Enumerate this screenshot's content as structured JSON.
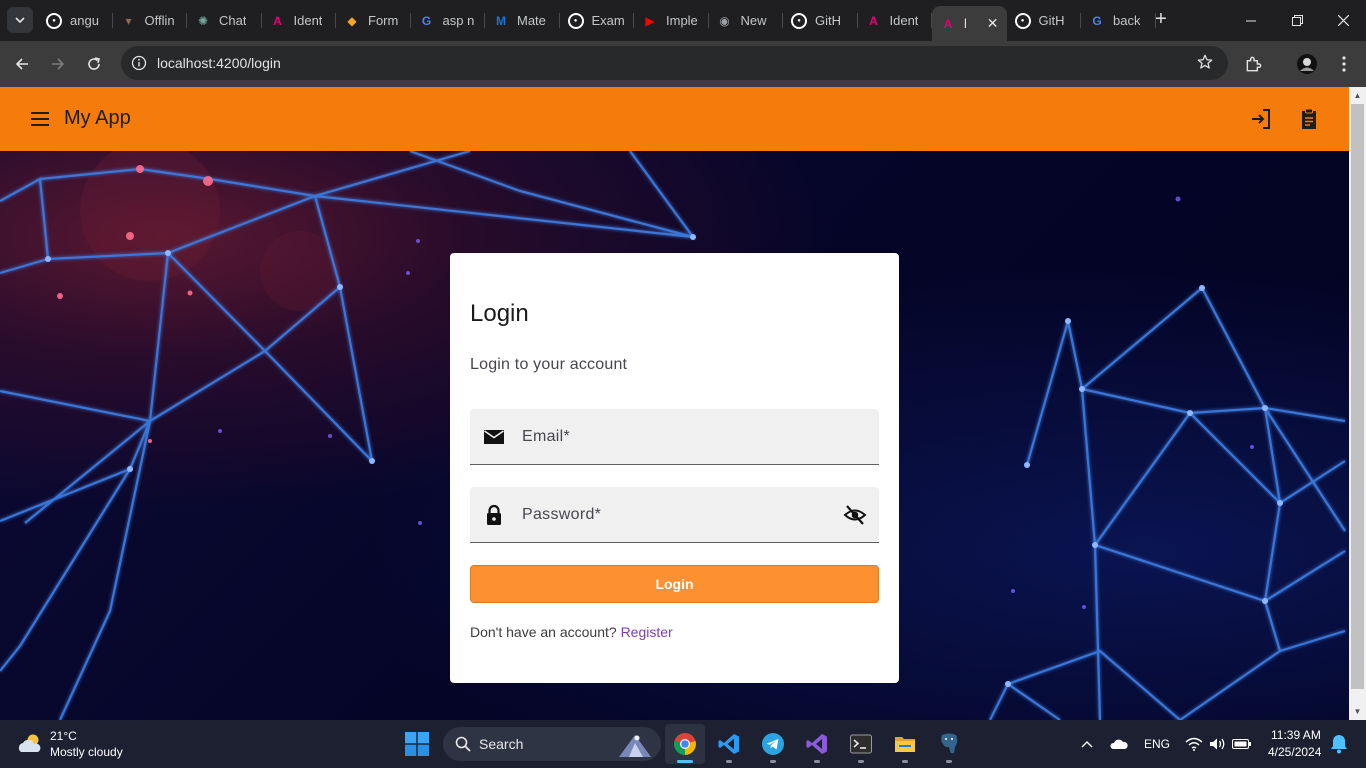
{
  "browser": {
    "tabs": [
      {
        "title": "angu",
        "icon": "github-icon",
        "color": "#ffffff"
      },
      {
        "title": "Offlin",
        "icon": "offline-icon",
        "color": "#8a6a58"
      },
      {
        "title": "Chat",
        "icon": "chatgpt-icon",
        "color": "#74aa9c"
      },
      {
        "title": "Ident",
        "icon": "angular-icon",
        "color": "#e40078"
      },
      {
        "title": "Form",
        "icon": "shield-icon",
        "color": "#f5a623"
      },
      {
        "title": "asp n",
        "icon": "google-icon",
        "color": "#4285f4"
      },
      {
        "title": "Mate",
        "icon": "mui-icon",
        "color": "#1976d2"
      },
      {
        "title": "Exam",
        "icon": "github-icon",
        "color": "#ffffff"
      },
      {
        "title": "Imple",
        "icon": "youtube-icon",
        "color": "#ff0000"
      },
      {
        "title": "New",
        "icon": "chrome-icon",
        "color": "#9aa0a6"
      },
      {
        "title": "GitH",
        "icon": "github-icon",
        "color": "#ffffff"
      },
      {
        "title": "Ident",
        "icon": "angular-icon",
        "color": "#e40078"
      },
      {
        "title": "l",
        "icon": "angular-icon",
        "color": "#e40078",
        "active": true
      },
      {
        "title": "GitH",
        "icon": "github-icon",
        "color": "#ffffff"
      },
      {
        "title": "back",
        "icon": "google-icon",
        "color": "#4285f4"
      }
    ],
    "url": "localhost:4200/login"
  },
  "app": {
    "title": "My App",
    "accent": "#f57c0b"
  },
  "login": {
    "title": "Login",
    "subtitle": "Login to your account",
    "email_label": "Email*",
    "password_label": "Password*",
    "submit_label": "Login",
    "no_account_text": "Don't have an account?",
    "register_link": "Register",
    "button_color": "#fd9031"
  },
  "taskbar": {
    "weather": {
      "temp": "21°C",
      "desc": "Mostly cloudy"
    },
    "search_label": "Search",
    "language": "ENG",
    "time": "11:39 AM",
    "date": "4/25/2024",
    "apps": [
      "chrome-icon",
      "vscode-icon",
      "telegram-icon",
      "visual-studio-icon",
      "terminal-icon",
      "file-explorer-icon",
      "postgres-icon"
    ]
  }
}
